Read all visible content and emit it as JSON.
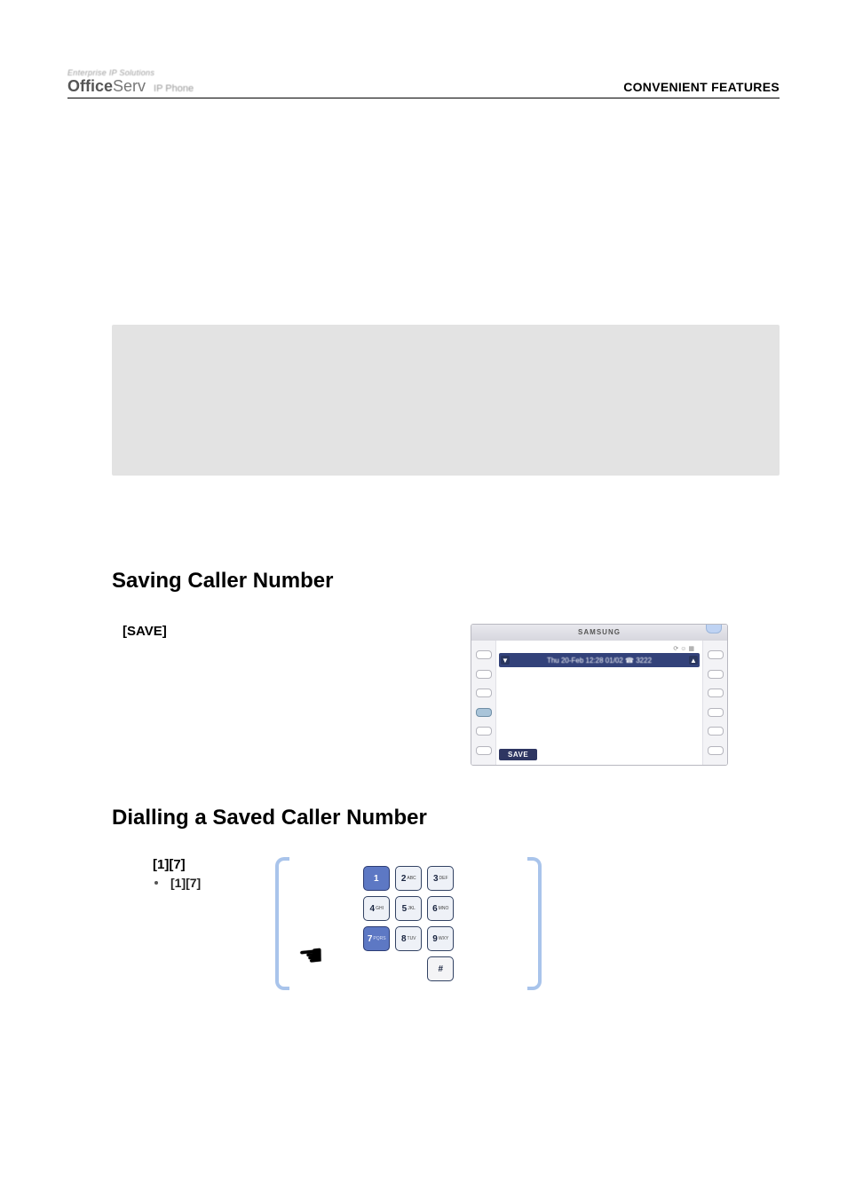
{
  "header": {
    "logo_top": "Enterprise IP Solutions",
    "logo_main_strong": "Office",
    "logo_main_serv": "Serv",
    "logo_sub": "IP Phone",
    "right": "CONVENIENT FEATURES"
  },
  "section_save": {
    "heading": "Saving Caller Number",
    "left_label": "[SAVE]"
  },
  "phone": {
    "brand": "SAMSUNG",
    "title_bar_text": "Thu 20-Feb 12:28 01/02 ☎ 3222",
    "softkey": "SAVE",
    "arrow_down": "▼",
    "arrow_up": "▲"
  },
  "section_dial": {
    "heading": "Dialling a Saved Caller Number",
    "line1": "[1][7]",
    "bullet": "[1][7]"
  },
  "keypad": {
    "keys": [
      {
        "num": "1",
        "sub": ""
      },
      {
        "num": "2",
        "sub": "ABC"
      },
      {
        "num": "3",
        "sub": "DEF"
      },
      {
        "num": "4",
        "sub": "GHI"
      },
      {
        "num": "5",
        "sub": "JKL"
      },
      {
        "num": "6",
        "sub": "MNO"
      },
      {
        "num": "7",
        "sub": "PQRS"
      },
      {
        "num": "8",
        "sub": "TUV"
      },
      {
        "num": "9",
        "sub": "WXY"
      },
      {
        "num": "",
        "sub": ""
      },
      {
        "num": "",
        "sub": ""
      },
      {
        "num": "#",
        "sub": ""
      }
    ],
    "hand": "☚"
  }
}
